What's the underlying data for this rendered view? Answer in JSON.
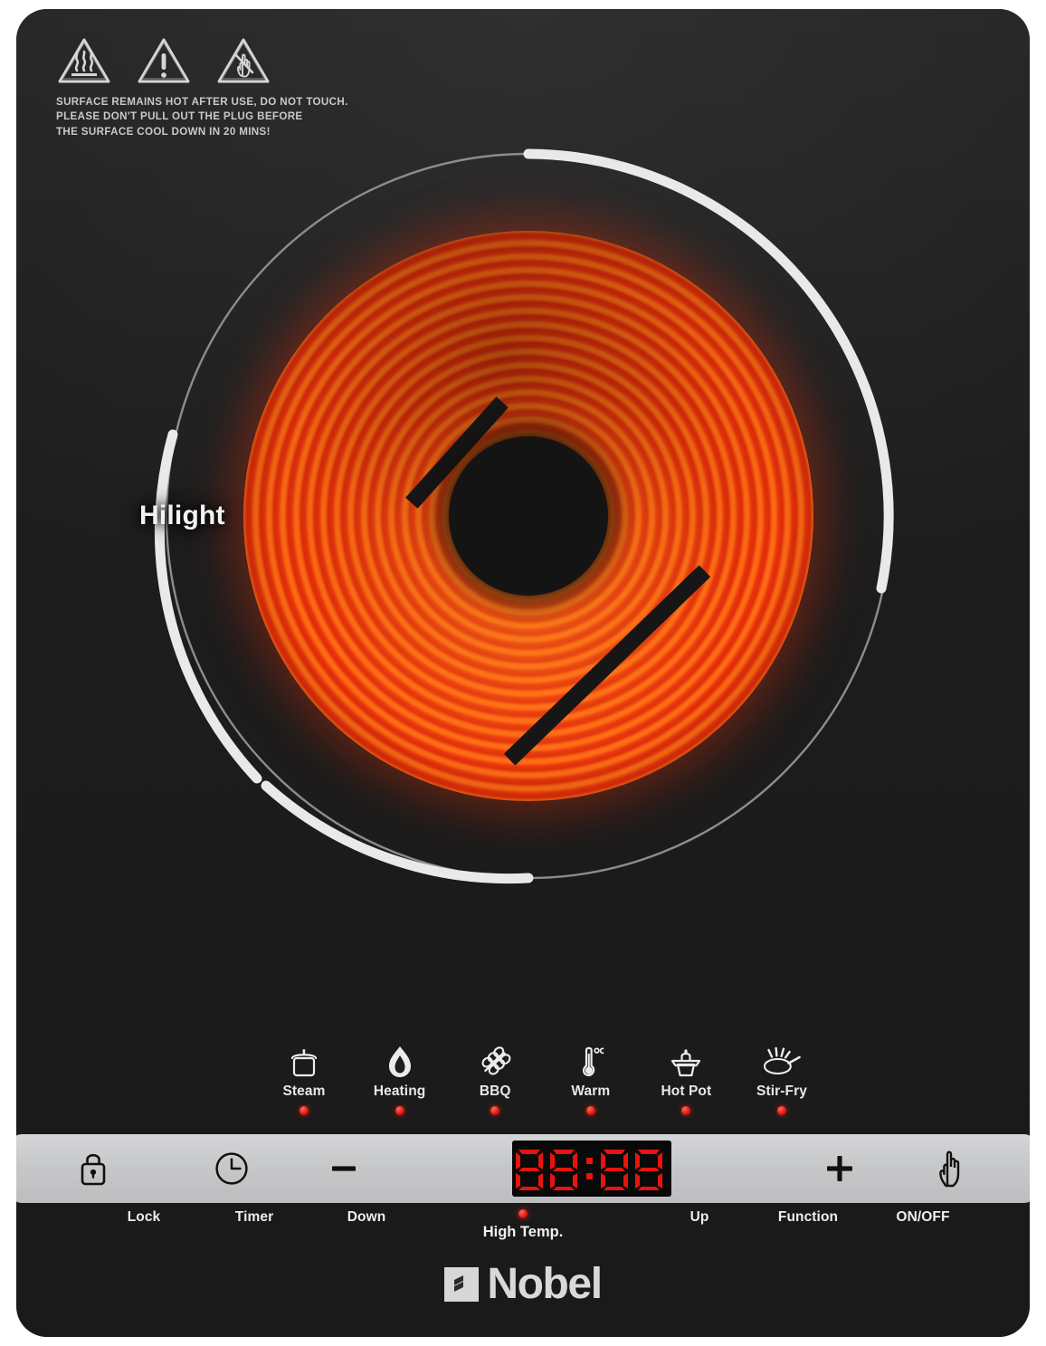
{
  "product": {
    "brand_name": "Nobel",
    "brand_mark_icon": "nobel-logo-mark",
    "hob_label": "Hilight"
  },
  "warning": {
    "icons": [
      "hot-surface-warning-icon",
      "general-warning-icon",
      "do-not-touch-warning-icon"
    ],
    "text": "SURFACE REMAINS HOT AFTER USE, DO NOT TOUCH.\nPLEASE DON'T PULL OUT THE PLUG BEFORE\nTHE SURFACE COOL DOWN IN 20 MINS!"
  },
  "modes": [
    {
      "label": "Steam",
      "icon": "pot-icon",
      "led": "on"
    },
    {
      "label": "Heating",
      "icon": "flame-icon",
      "led": "on"
    },
    {
      "label": "BBQ",
      "icon": "skewer-icon",
      "led": "on"
    },
    {
      "label": "Warm",
      "icon": "thermometer-icon",
      "led": "on"
    },
    {
      "label": "Hot Pot",
      "icon": "hotpot-icon",
      "led": "on"
    },
    {
      "label": "Stir-Fry",
      "icon": "frying-pan-icon",
      "led": "on"
    }
  ],
  "controls": [
    {
      "label": "Lock",
      "icon": "lock-icon"
    },
    {
      "label": "Timer",
      "icon": "clock-icon"
    },
    {
      "label": "Down",
      "icon": "minus-icon"
    },
    {
      "label": "Up",
      "icon": "plus-icon"
    },
    {
      "label": "Function",
      "icon": "hand-pointer-icon"
    },
    {
      "label": "ON/OFF",
      "icon": "power-plug-icon"
    }
  ],
  "display": {
    "value": "88:88",
    "segment_color": "#e8140f",
    "background_color": "#0a0a0a"
  },
  "status": {
    "high_temp_label": "High Temp.",
    "high_temp_led": "on"
  },
  "colors": {
    "body": "#1e1e1e",
    "control_bar": "#c6c7c9",
    "coil_hot": "#ff6a14",
    "coil_deep": "#e0300a",
    "led_red": "#e01f12",
    "ring_white": "#e9e9e9",
    "ring_thin": "#8d8d8d"
  }
}
